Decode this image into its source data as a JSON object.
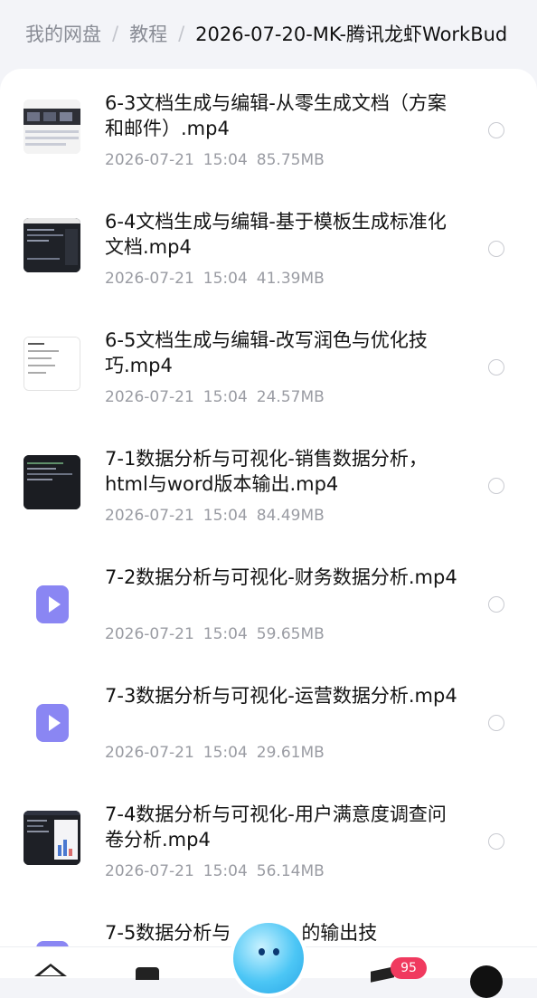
{
  "breadcrumb": {
    "root": "我的网盘",
    "level1": "教程",
    "current": "2026-07-20-MK-腾讯龙虾WorkBud"
  },
  "files": [
    {
      "title": "6-3文档生成与编辑-从零生成文档（方案和邮件）.mp4",
      "date": "2026-07-21",
      "time": "15:04",
      "size": "85.75MB",
      "thumb": "screenshot-dark-rows"
    },
    {
      "title": "6-4文档生成与编辑-基于模板生成标准化文档.mp4",
      "date": "2026-07-21",
      "time": "15:04",
      "size": "41.39MB",
      "thumb": "screenshot-dark-editor"
    },
    {
      "title": "6-5文档生成与编辑-改写润色与优化技巧.mp4",
      "date": "2026-07-21",
      "time": "15:04",
      "size": "24.57MB",
      "thumb": "screenshot-light-doc"
    },
    {
      "title": "7-1数据分析与可视化-销售数据分析，html与word版本输出.mp4",
      "date": "2026-07-21",
      "time": "15:04",
      "size": "84.49MB",
      "thumb": "screenshot-dark-terminal"
    },
    {
      "title": "7-2数据分析与可视化-财务数据分析.mp4",
      "date": "2026-07-21",
      "time": "15:04",
      "size": "59.65MB",
      "thumb": "video-play-icon"
    },
    {
      "title": "7-3数据分析与可视化-运营数据分析.mp4",
      "date": "2026-07-21",
      "time": "15:04",
      "size": "29.61MB",
      "thumb": "video-play-icon"
    },
    {
      "title": "7-4数据分析与可视化-用户满意度调查问卷分析.mp4",
      "date": "2026-07-21",
      "time": "15:04",
      "size": "56.14MB",
      "thumb": "screenshot-dark-chart"
    },
    {
      "title": "7-5数据分析与",
      "title_tail": "的输出技"
    }
  ],
  "bottom_nav": {
    "badge_count": "95",
    "icons": [
      "home-icon",
      "files-icon",
      "assistant-orb-icon",
      "message-icon",
      "profile-icon"
    ]
  },
  "colors": {
    "accent": "#8a86f3",
    "badge": "#f03a5f",
    "page_bg": "#f3f4f8"
  }
}
